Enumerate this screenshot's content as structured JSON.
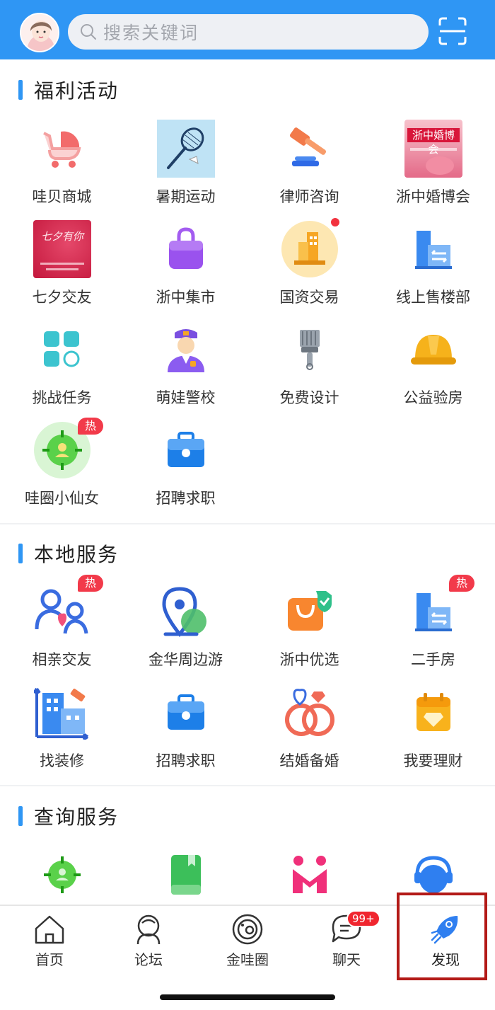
{
  "header": {
    "search_placeholder": "搜索关键词"
  },
  "sections": {
    "welfare": {
      "title": "福利活动",
      "items": [
        {
          "label": "哇贝商城",
          "icon": "stroller-icon"
        },
        {
          "label": "暑期运动",
          "icon": "badminton-icon"
        },
        {
          "label": "律师咨询",
          "icon": "gavel-icon"
        },
        {
          "label": "浙中婚博会",
          "icon": "wedding-expo-thumbnail",
          "thumb_text": "浙中婚博会"
        },
        {
          "label": "七夕交友",
          "icon": "qixi-thumbnail",
          "thumb_text": "七夕有你"
        },
        {
          "label": "浙中集市",
          "icon": "shopping-bag-icon"
        },
        {
          "label": "国资交易",
          "icon": "building-icon"
        },
        {
          "label": "线上售楼部",
          "icon": "sales-office-icon"
        },
        {
          "label": "挑战任务",
          "icon": "grid-apps-icon"
        },
        {
          "label": "萌娃警校",
          "icon": "police-icon"
        },
        {
          "label": "免费设计",
          "icon": "paint-brush-icon"
        },
        {
          "label": "公益验房",
          "icon": "hard-hat-icon"
        },
        {
          "label": "哇圈小仙女",
          "icon": "target-person-icon",
          "badge": "热"
        },
        {
          "label": "招聘求职",
          "icon": "briefcase-icon"
        }
      ]
    },
    "local": {
      "title": "本地服务",
      "items": [
        {
          "label": "相亲交友",
          "icon": "dating-icon",
          "badge": "热"
        },
        {
          "label": "金华周边游",
          "icon": "map-pin-icon"
        },
        {
          "label": "浙中优选",
          "icon": "shopping-bag-check-icon"
        },
        {
          "label": "二手房",
          "icon": "second-hand-house-icon",
          "badge": "热"
        },
        {
          "label": "找装修",
          "icon": "renovation-icon"
        },
        {
          "label": "招聘求职",
          "icon": "briefcase-icon"
        },
        {
          "label": "结婚备婚",
          "icon": "rings-icon"
        },
        {
          "label": "我要理财",
          "icon": "finance-calendar-icon"
        }
      ]
    },
    "query": {
      "title": "查询服务",
      "items": [
        {
          "icon": "target-person-icon"
        },
        {
          "icon": "green-book-icon"
        },
        {
          "icon": "m-logo-icon"
        },
        {
          "icon": "customer-service-icon"
        }
      ]
    }
  },
  "bottom_nav": {
    "items": [
      {
        "label": "首页",
        "icon": "home-icon"
      },
      {
        "label": "论坛",
        "icon": "forum-icon"
      },
      {
        "label": "金哇圈",
        "icon": "planet-icon"
      },
      {
        "label": "聊天",
        "icon": "chat-icon",
        "badge": "99+"
      },
      {
        "label": "发现",
        "icon": "rocket-icon",
        "active": true
      }
    ]
  },
  "colors": {
    "header_bg": "#2f96f4",
    "accent": "#2f96f4",
    "hot_badge": "#f23a4a",
    "highlight_box": "#b31a17"
  }
}
